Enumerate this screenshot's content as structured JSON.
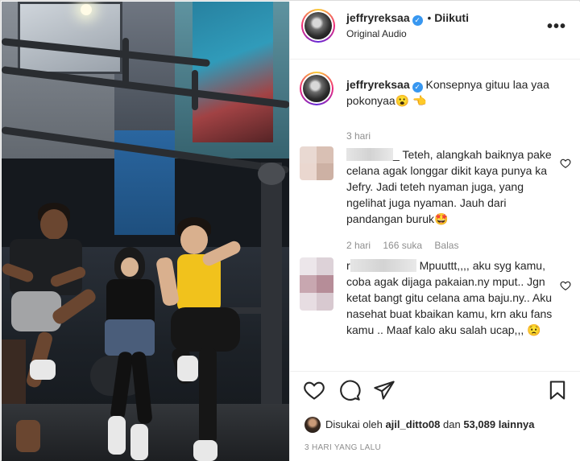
{
  "post": {
    "username": "jeffryreksaa",
    "follow_status": "Diikuti",
    "audio": "Original Audio",
    "more_label": "•••"
  },
  "caption": {
    "username": "jeffryreksaa",
    "text": "Konsepnya gituu laa yaa pokonyaa😮 👈",
    "time": "3 hari"
  },
  "comments": [
    {
      "username_blurred": true,
      "name_suffix": "_",
      "text": "Teteh, alangkah baiknya pake celana agak longgar dikit kaya punya ka Jefry. Jadi teteh nyaman juga, yang ngelihat juga nyaman. Jauh dari pandangan buruk🤩",
      "time": "2 hari",
      "likes": "166 suka",
      "reply": "Balas"
    },
    {
      "username_blurred": true,
      "name_prefix": "r",
      "text": "Mpuuttt,,,, aku syg kamu, coba agak dijaga pakaian.ny mput.. Jgn ketat bangt gitu celana ama baju.ny.. Aku nasehat buat kbaikan kamu, krn aku fans kamu .. Maaf kalo aku salah ucap,,, 😟"
    }
  ],
  "actions": {
    "like_icon": "heart-icon",
    "comment_icon": "comment-icon",
    "share_icon": "share-icon",
    "save_icon": "bookmark-icon"
  },
  "likes": {
    "prefix": "Disukai oleh",
    "first_liker": "ajil_ditto08",
    "conjunction": "dan",
    "others": "53,089 lainnya"
  },
  "post_date": "3 HARI YANG LALU"
}
